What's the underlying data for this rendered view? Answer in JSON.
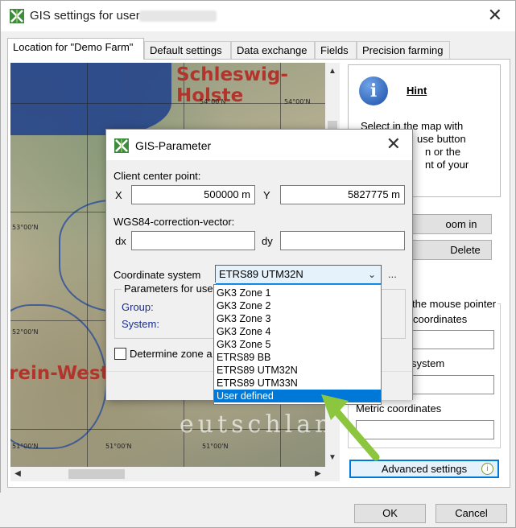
{
  "window": {
    "title": "GIS settings for user"
  },
  "tabs": [
    {
      "label": "Location for \"Demo Farm\"",
      "active": true
    },
    {
      "label": "Default settings",
      "active": false
    },
    {
      "label": "Data exchange",
      "active": false
    },
    {
      "label": "Fields",
      "active": false
    },
    {
      "label": "Precision farming",
      "active": false
    }
  ],
  "map": {
    "labels": {
      "region_top": "Schleswig-Holste",
      "region_left": "rein-Westf",
      "country": "eutschland"
    },
    "coords": [
      "54°00'N",
      "54°00'N",
      "53°00'N",
      "52°00'N",
      "52°00'N",
      "51°00'N",
      "51°00'N",
      "51°00'N"
    ]
  },
  "hint": {
    "title": "Hint",
    "text_lines": [
      "Select in the map with",
      "use button",
      "n or the",
      "nt of your"
    ]
  },
  "side_buttons": {
    "zoom_in": "oom in",
    "delete": "Delete"
  },
  "mouse_pointer_group": {
    "label": "the mouse pointer",
    "geo_label": "coordinates",
    "system_label": "system",
    "metric_label": "Metric coordinates"
  },
  "advanced_settings": {
    "label": "Advanced settings"
  },
  "footer": {
    "ok": "OK",
    "cancel": "Cancel"
  },
  "gis_dialog": {
    "title": "GIS-Parameter",
    "client_center_label": "Client center point:",
    "x_label": "X",
    "x_value": "500000 m",
    "y_label": "Y",
    "y_value": "5827775 m",
    "wgs_label": "WGS84-correction-vector:",
    "dx_label": "dx",
    "dx_value": "",
    "dy_label": "dy",
    "dy_value": "",
    "coord_system_label": "Coordinate system",
    "coord_system_value": "ETRS89 UTM32N",
    "more_button": "...",
    "params_label": "Parameters for use",
    "group_label": "Group:",
    "system_label": "System:",
    "determine_zone_label": "Determine zone a"
  },
  "coordinate_options": [
    {
      "label": "GK3  Zone 1",
      "selected": false
    },
    {
      "label": "GK3  Zone 2",
      "selected": false
    },
    {
      "label": "GK3  Zone 3",
      "selected": false
    },
    {
      "label": "GK3  Zone 4",
      "selected": false
    },
    {
      "label": "GK3  Zone 5",
      "selected": false
    },
    {
      "label": "ETRS89 BB",
      "selected": false
    },
    {
      "label": "ETRS89 UTM32N",
      "selected": false
    },
    {
      "label": "ETRS89 UTM33N",
      "selected": false
    },
    {
      "label": "User defined",
      "selected": true
    }
  ],
  "colors": {
    "accent": "#0078d7",
    "annotation_arrow": "#8cc63f"
  }
}
